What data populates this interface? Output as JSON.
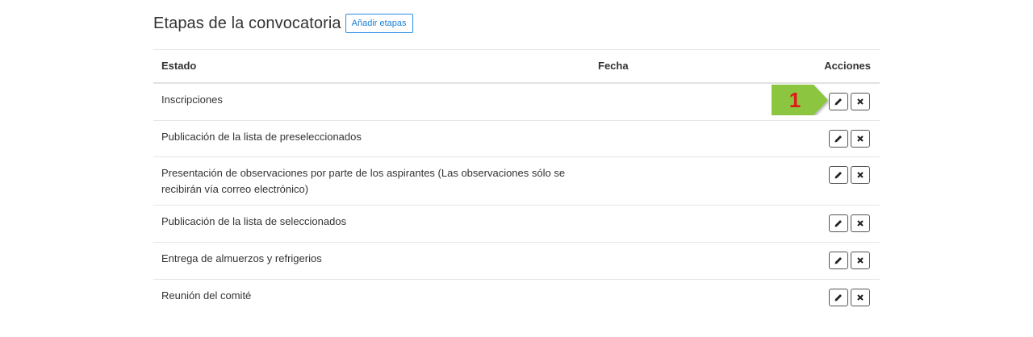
{
  "header": {
    "title": "Etapas de la convocatoria",
    "add_button_label": "Añadir etapas"
  },
  "table": {
    "columns": [
      "Estado",
      "Fecha",
      "Acciones"
    ],
    "rows": [
      {
        "estado": "Inscripciones",
        "fecha": ""
      },
      {
        "estado": "Publicación de la lista de preseleccionados",
        "fecha": ""
      },
      {
        "estado": "Presentación de observaciones por parte de los aspirantes (Las observaciones sólo se recibirán vía correo electrónico)",
        "fecha": ""
      },
      {
        "estado": "Publicación de la lista de seleccionados",
        "fecha": ""
      },
      {
        "estado": "Entrega de almuerzos y refrigerios",
        "fecha": ""
      },
      {
        "estado": "Reunión del comité",
        "fecha": ""
      }
    ],
    "row_actions": [
      "pencil-icon",
      "close-icon"
    ]
  },
  "callout": {
    "number": "1",
    "color": "#8cc63f",
    "text_color": "#e01a1a"
  },
  "colors": {
    "accent": "#1a7fd6",
    "border": "#e6e6e6"
  }
}
